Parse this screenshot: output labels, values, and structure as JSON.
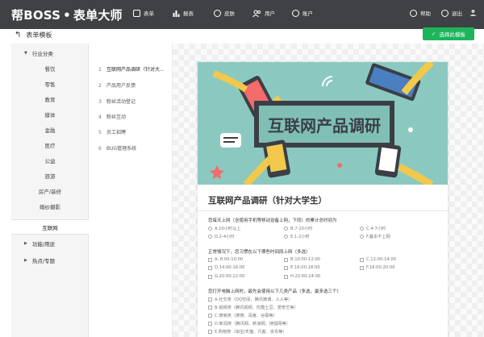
{
  "app": {
    "logo_left": "帮BOSS",
    "logo_dot": "•",
    "logo_right": "表单大师"
  },
  "nav": {
    "items": [
      {
        "label": "表单",
        "icon": "form-icon"
      },
      {
        "label": "报表",
        "icon": "chart-icon"
      },
      {
        "label": "皮肤",
        "icon": "skin-icon"
      },
      {
        "label": "用户",
        "icon": "users-icon"
      },
      {
        "label": "账户",
        "icon": "account-icon"
      }
    ],
    "help": "帮助",
    "logout": "退出"
  },
  "subbar": {
    "back_label": "表单模板",
    "select_button": "选择此模板"
  },
  "sidebar": {
    "industry_group": "行业分类",
    "industry_items": [
      "餐饮",
      "零售",
      "教育",
      "媒体",
      "金融",
      "医疗",
      "公益",
      "旅游",
      "房产/装修",
      "婚纱摄影",
      "互联网"
    ],
    "active_item": "互联网",
    "function_group": "功能/用途",
    "topic_group": "热点/专题"
  },
  "templates": [
    {
      "num": "1",
      "label": "互联网产品调研（针对大..."
    },
    {
      "num": "2",
      "label": "产品用户反馈"
    },
    {
      "num": "3",
      "label": "粉丝活动登记"
    },
    {
      "num": "4",
      "label": "粉丝互动"
    },
    {
      "num": "5",
      "label": "员工招聘"
    },
    {
      "num": "6",
      "label": "BUG管理系统"
    }
  ],
  "preview": {
    "banner_title": "互联网产品调研",
    "form_title": "互联网产品调研（针对大学生）",
    "questions": [
      {
        "text": "您每天上网（含使用手机等移动设备上网，下同）的累计总时间为",
        "options": [
          "A.10小时以上",
          "B.7-10小时",
          "C.4-7小时",
          "D.2-4小时",
          "E.1-2小时",
          "F.基本不上网"
        ]
      },
      {
        "text": "正常情况下，您习惯在以下哪些时间段上网（多选）",
        "options": [
          "A. 8:00-10:00",
          "B.10:00-12:00",
          "C.12:00-14:00",
          "D.14:00-16:00",
          "E.16:00-18:00",
          "F.18:00-20:00",
          "G.20:00-22:00",
          "H.22:00-24:00"
        ]
      },
      {
        "text": "您打开电脑上网时，最先会使用以下几类产品（多选，最多选三个）",
        "options": [
          "A.社交类（QQ空间、腾讯微博、人人等）",
          "B.视频类（腾讯视频、优酷土豆、爱奇艺等）",
          "C.搜索类（搜搜、百度、谷歌等）",
          "D.新闻类（腾讯网、新浪网、搜狐网等）",
          "E.购物类（淘宝/天猫、凡客、京东等）"
        ]
      }
    ]
  },
  "colors": {
    "topbar": "#3f4144",
    "accent": "#1db45c",
    "banner": "#8bc9c0"
  }
}
